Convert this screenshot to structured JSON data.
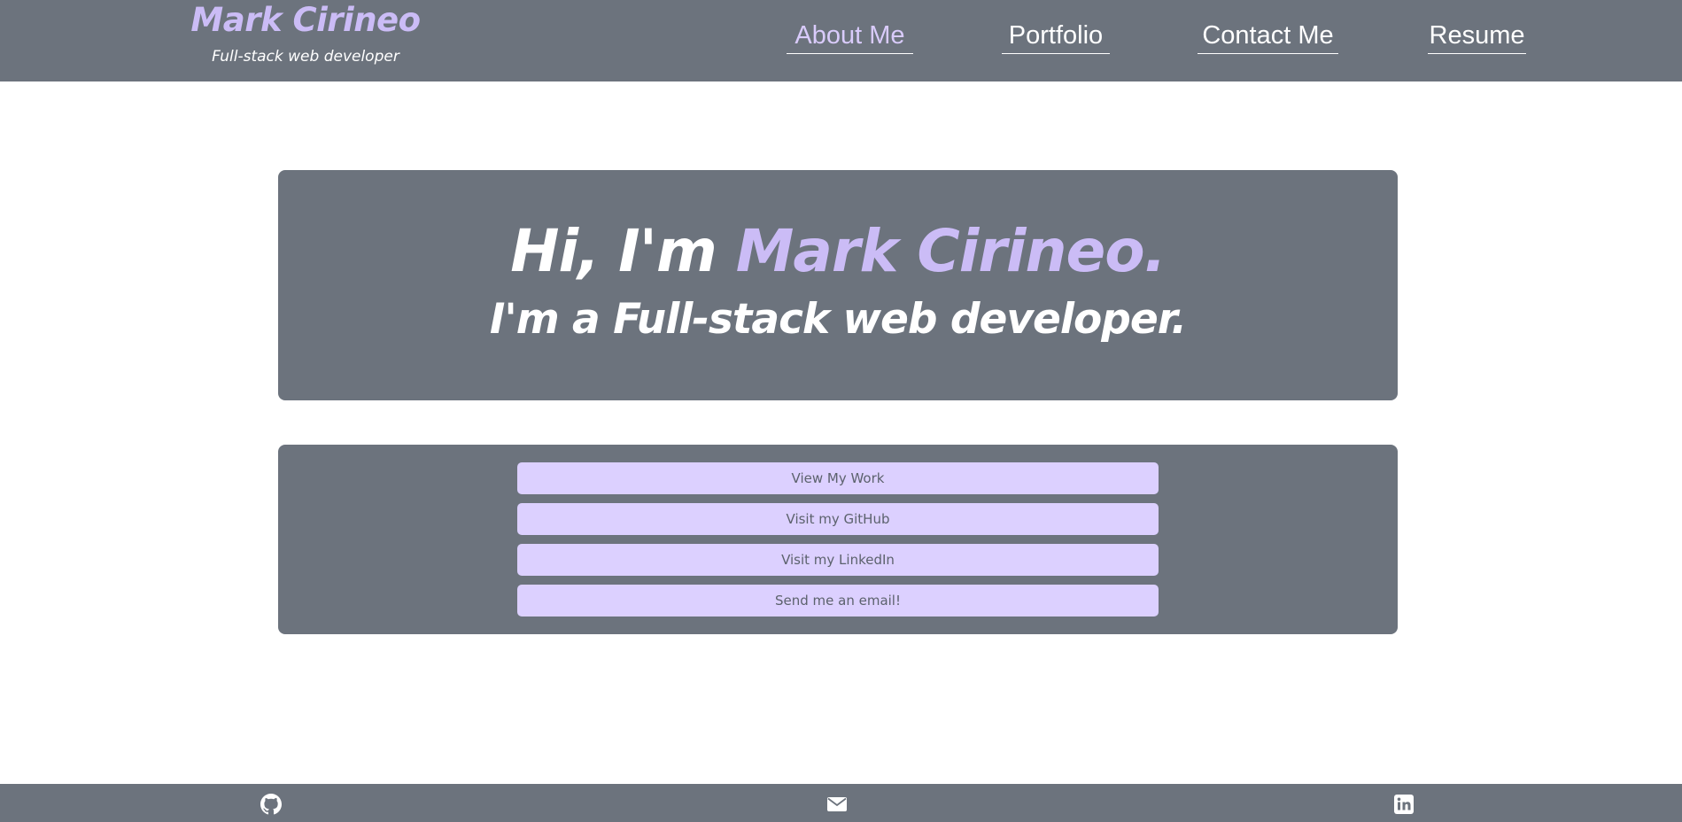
{
  "header": {
    "brand_name": "Mark Cirineo",
    "tagline": "Full-stack web developer",
    "nav": {
      "about": "About Me",
      "portfolio": "Portfolio",
      "contact": "Contact Me",
      "resume": "Resume"
    },
    "active_nav": "About Me"
  },
  "hero": {
    "greeting": "Hi, I'm ",
    "name": "Mark Cirineo.",
    "subtitle": "I'm a Full-stack web developer."
  },
  "actions": {
    "view_work": "View My Work",
    "github": "Visit my GitHub",
    "linkedin": "Visit my LinkedIn",
    "email": "Send me an email!"
  },
  "footer": {
    "icons": [
      "github-icon",
      "envelope-icon",
      "linkedin-icon"
    ]
  },
  "colors": {
    "panel": "#6c737d",
    "accent": "#cbbcf6",
    "button": "#dcd0ff",
    "button_text": "#5c626d",
    "background": "#ffffff"
  }
}
